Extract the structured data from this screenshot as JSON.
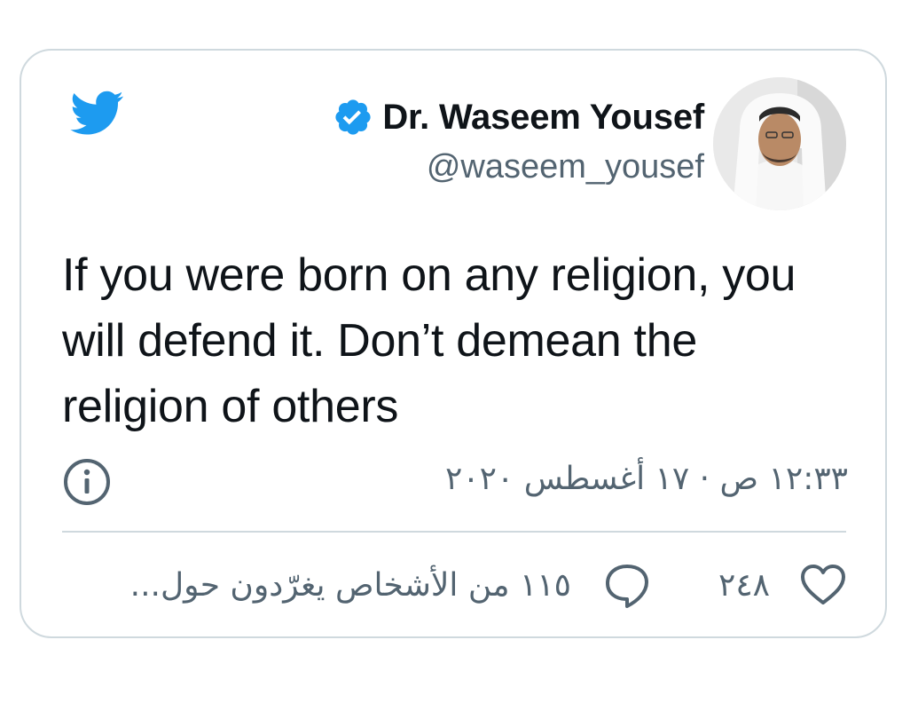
{
  "colors": {
    "twitter_blue": "#1d9bf0",
    "secondary_text": "#536471",
    "border": "#cfd9de"
  },
  "icons": [
    "twitter-bird-icon",
    "verified-badge-icon",
    "info-icon",
    "heart-icon",
    "reply-bubble-icon"
  ],
  "author": {
    "display_name": "Dr. Waseem Yousef",
    "handle": "@waseem_yousef"
  },
  "tweet": {
    "text": "If you were born on any religion, you will defend it. Don’t demean the religion of others",
    "timestamp": "١٢:٣٣ ص · ١٧ أغسطس ٢٠٢٠"
  },
  "actions": {
    "like_count": "٢٤٨",
    "reply_summary": "١١٥ من الأشخاص يغرّدون حول..."
  }
}
